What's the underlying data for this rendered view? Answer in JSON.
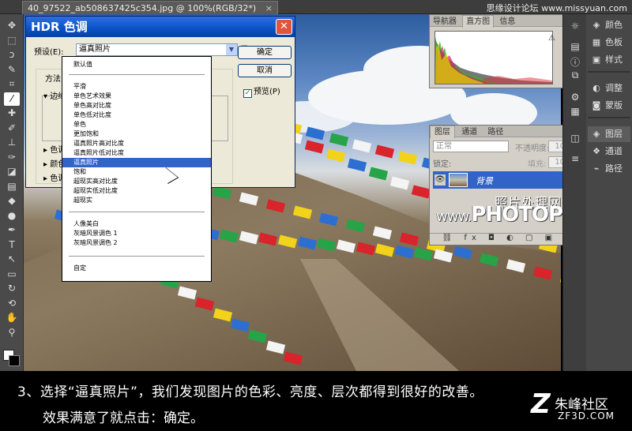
{
  "app": {
    "doc_tab": "40_97522_ab508637425c354.jpg @ 100%(RGB/32*)",
    "doc_tab_close": "×",
    "top_watermark": "思缘设计论坛 www.missyuan.com"
  },
  "tools": [
    {
      "icon": "move-icon",
      "glyph": "✥"
    },
    {
      "icon": "marquee-icon",
      "glyph": "⬚"
    },
    {
      "icon": "lasso-icon",
      "glyph": "ↄ"
    },
    {
      "icon": "quick-select-icon",
      "glyph": "✎"
    },
    {
      "icon": "crop-icon",
      "glyph": "⌗"
    },
    {
      "icon": "eyedropper-icon",
      "glyph": "⁄"
    },
    {
      "icon": "healing-icon",
      "glyph": "✚"
    },
    {
      "icon": "brush-icon",
      "glyph": "✐"
    },
    {
      "icon": "stamp-icon",
      "glyph": "⊥"
    },
    {
      "icon": "history-brush-icon",
      "glyph": "✑"
    },
    {
      "icon": "eraser-icon",
      "glyph": "◪"
    },
    {
      "icon": "gradient-icon",
      "glyph": "▤"
    },
    {
      "icon": "blur-icon",
      "glyph": "◆"
    },
    {
      "icon": "dodge-icon",
      "glyph": "●"
    },
    {
      "icon": "pen-icon",
      "glyph": "✒"
    },
    {
      "icon": "type-icon",
      "glyph": "T"
    },
    {
      "icon": "path-select-icon",
      "glyph": "↖"
    },
    {
      "icon": "shape-icon",
      "glyph": "▭"
    },
    {
      "icon": "3d-rotate-icon",
      "glyph": "↻"
    },
    {
      "icon": "3d-orbit-icon",
      "glyph": "⟲"
    },
    {
      "icon": "hand-icon",
      "glyph": "✋"
    },
    {
      "icon": "zoom-icon",
      "glyph": "⚲"
    }
  ],
  "histogram": {
    "tabs": [
      "导航器",
      "直方图",
      "信息"
    ],
    "active_tab": 1,
    "warning": "⚠"
  },
  "layers": {
    "tabs": [
      "图层",
      "通道",
      "路径"
    ],
    "blend_mode": "正常",
    "opacity_label": "不透明度:",
    "opacity_value": "100%",
    "lock_label": "锁定:",
    "fill_label": "填充:",
    "fill_value": "100%",
    "layer_name": "背景",
    "lock_glyph": "🔒",
    "eye_glyph": "👁",
    "footer_icons": "⛓ fx ◘ ◐ ▢ ▣ 🗑"
  },
  "overlay_watermark": {
    "cn": "照片处理网",
    "en_small": "www.",
    "en": "PHOTOPS.COM"
  },
  "right_panel": [
    {
      "icon": "color-icon",
      "label": "颜色",
      "glyph": "◈"
    },
    {
      "icon": "swatches-icon",
      "label": "色板",
      "glyph": "▦"
    },
    {
      "icon": "styles-icon",
      "label": "样式",
      "glyph": "▣"
    },
    {
      "icon": "adjustments-icon",
      "label": "调整",
      "glyph": "◐"
    },
    {
      "icon": "masks-icon",
      "label": "蒙版",
      "glyph": "◙"
    },
    {
      "icon": "layers-icon",
      "label": "图层",
      "glyph": "◈"
    },
    {
      "icon": "channels-icon",
      "label": "通道",
      "glyph": "❖"
    },
    {
      "icon": "paths-icon",
      "label": "路径",
      "glyph": "⌁"
    }
  ],
  "dock_icons": [
    "☼",
    "▤",
    "ⓘ",
    "⧉",
    "⚙",
    "▦",
    "◫",
    "≡"
  ],
  "dialog": {
    "title": "HDR 色调",
    "close_glyph": "✕",
    "preset_label": "预设(E):",
    "preset_value": "逼真照片",
    "preset_arrow": "▼",
    "menu_glyph": "☰",
    "ok": "确定",
    "cancel": "取消",
    "preview_label": "预览(P)",
    "preview_check": "✓",
    "method_label": "方法:",
    "sections": [
      "▾ 边缘",
      "▸ 色调",
      "▸ 颜色",
      "▸ 色调"
    ]
  },
  "dropdown": {
    "options": [
      "默认值",
      "平滑",
      "单色艺术效果",
      "单色高对比度",
      "单色低对比度",
      "单色",
      "更加饱和",
      "逼真照片高对比度",
      "逼真照片低对比度",
      "逼真照片",
      "饱和",
      "超现实高对比度",
      "超现实低对比度",
      "超现实",
      "人像美白",
      "灰暗风景调色 1",
      "灰暗风景调色 2",
      "自定"
    ],
    "selected": "逼真照片"
  },
  "caption": {
    "line1": "3、选择“逼真照片”，我们发现图片的色彩、亮度、层次都得到很好的改善。",
    "line2": "效果满意了就点击：确定。"
  },
  "logo": {
    "mark": "Z",
    "name": "朱峰社区",
    "domain": "ZF3D.COM"
  }
}
